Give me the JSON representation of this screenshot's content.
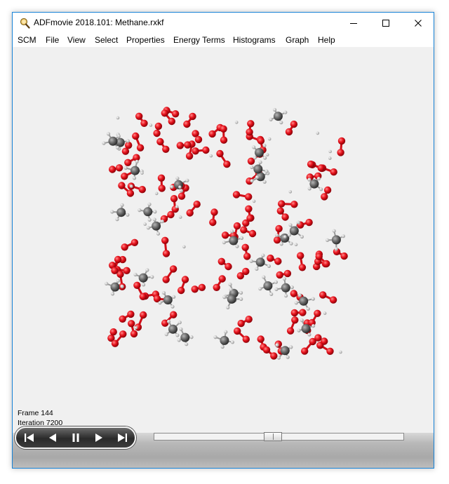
{
  "window": {
    "title": "ADFmovie 2018.101: Methane.rxkf"
  },
  "menu": [
    "SCM",
    "File",
    "View",
    "Select",
    "Properties",
    "Energy Terms",
    "Histograms",
    "Graph",
    "Help"
  ],
  "status": {
    "frame": "Frame 144",
    "iteration": "Iteration 7200"
  },
  "colors": {
    "oxygen": "#e8141e",
    "carbon": "#6e6e6e",
    "hydrogen": "#d8d8d8",
    "bond_oxygen": "#d00f18"
  },
  "icons": {
    "app": "magnifier-icon",
    "minimize": "minimize-icon",
    "maximize": "maximize-icon",
    "close": "close-icon",
    "first": "skip-to-start-icon",
    "back": "step-back-icon",
    "pause": "pause-icon",
    "forward": "step-forward-icon",
    "last": "skip-to-end-icon"
  },
  "playback": {
    "position_fraction": 0.47
  }
}
